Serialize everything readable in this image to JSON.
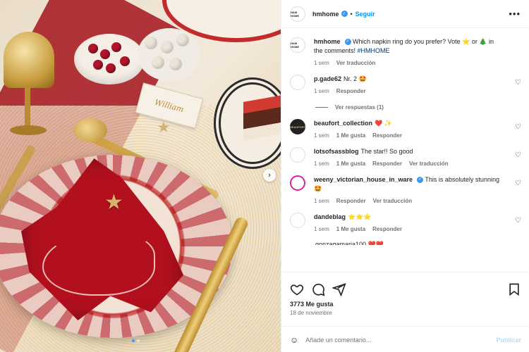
{
  "post": {
    "username": "hmhome",
    "avatar_text": "H&M HOME",
    "follow_label": "Seguir",
    "dot": "•",
    "more_label": "•••",
    "next_label": "›",
    "place_card_text": "William"
  },
  "caption": {
    "username": "hmhome",
    "text": "Which napkin ring do you prefer? Vote ⭐ or 🎄 in the comments!",
    "hashtag": "#HMHOME",
    "time": "1 sem",
    "translate": "Ver traducción"
  },
  "comments": [
    {
      "username": "p.gade62",
      "text": "Nr. 2 🤩",
      "time": "1 sem",
      "likes": "",
      "reply": "Responder",
      "translate": "",
      "avatar": "",
      "avatar_style": "plain"
    },
    {
      "username": "beaufort_collection",
      "text": "❤️ ✨",
      "time": "1 sem",
      "likes": "1 Me gusta",
      "reply": "Responder",
      "translate": "",
      "avatar": "BEAUFORT",
      "avatar_style": "dark"
    },
    {
      "username": "lotsofsassblog",
      "text": "The star!! So good",
      "time": "1 sem",
      "likes": "1 Me gusta",
      "reply": "Responder",
      "translate": "Ver traducción",
      "avatar": "",
      "avatar_style": "plain"
    },
    {
      "username": "weeny_victorian_house_in_ware",
      "text": "This is absolutely stunning 🤩",
      "time": "1 sem",
      "likes": "",
      "reply": "Responder",
      "translate": "Ver traducción",
      "avatar": "",
      "avatar_style": "ring",
      "verified": true
    },
    {
      "username": "dandeblag",
      "text": "⭐⭐⭐",
      "time": "1 sem",
      "likes": "1 Me gusta",
      "reply": "Responder",
      "translate": "",
      "avatar": "",
      "avatar_style": "plain"
    }
  ],
  "replies_label": "Ver respuestas (1)",
  "partial_comment": "gonzagamaria100 ❤️❤️",
  "footer": {
    "likes": "3773 Me gusta",
    "date": "18 de noviembre",
    "comment_placeholder": "Añade un comentario...",
    "post_label": "Publicar",
    "emoji_label": "☺"
  },
  "colors": {
    "accent": "#0095f6",
    "verified": "#3897f0",
    "muted": "#737373"
  }
}
